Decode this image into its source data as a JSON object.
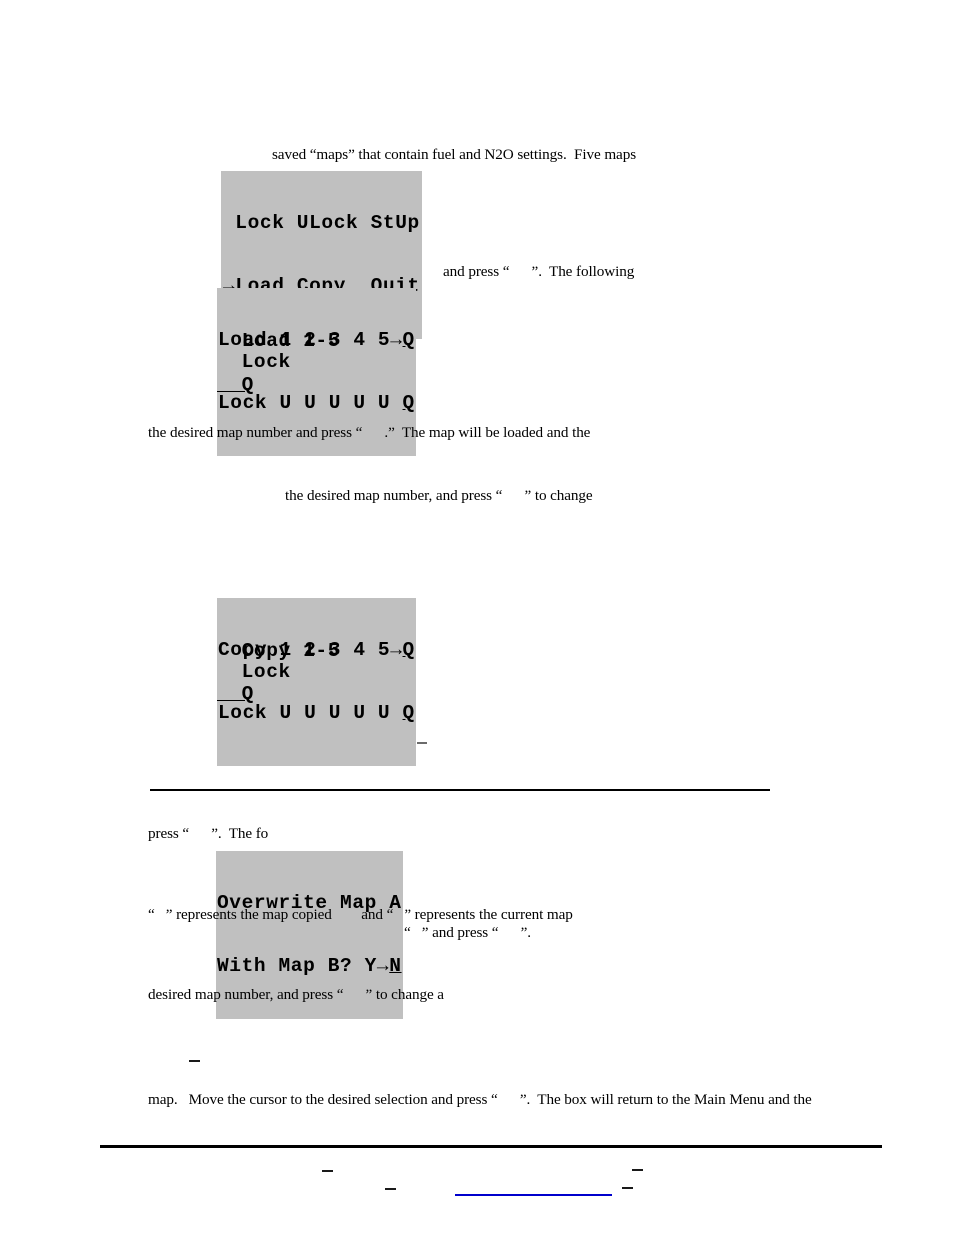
{
  "document": {
    "page_background": "#ffffff",
    "text_color": "#000000",
    "lcd_background": "#c0c0c0",
    "link_color": "#0000cc"
  },
  "paragraphs": {
    "line_saved_maps": "saved “maps” that contain fuel and N2O settings.  Five maps",
    "line_and_press_following": "and press “      ”.  The following",
    "line_desired_map_loaded": "the desired map number and press “      .”  The map will be loaded and the",
    "line_desired_map_change": "the desired map number, and press “      ” to change",
    "line_press_the_fo": "press “      ”.  The fo",
    "line_represents_copied": "“   ” represents the map copied        and “   ” represents the current map",
    "line_and_press_short": "“   ” and press “      ”.",
    "line_desired_map_change_a": "desired map number, and press “      ” to change a",
    "line_map_move_cursor": "map.   Move the cursor to the desired selection and press “      ”.  The box will return to the Main Menu and the"
  },
  "lcd_displays": {
    "main_menu": {
      "name": "main-menu-display",
      "line1": " Lock ULock StUp",
      "line2_prefix": "→",
      "line2_cursor_char": "L",
      "line2_rest": "oad Copy  Quit"
    },
    "load_menu": {
      "name": "load-map-display",
      "line1_prefix": "Load 1 2 3 4 5→",
      "line1_cursor_char": "Q",
      "line2_prefix": "Lock U U U U U ",
      "line2_cursor_char": "Q",
      "legend": [
        "  Load 1-5",
        "  Lock",
        "  Q"
      ]
    },
    "copy_menu": {
      "name": "copy-map-display",
      "line1_prefix": "Copy 1 2 3 4 5→",
      "line1_cursor_char": "Q",
      "line2_prefix": "Lock U U U U U ",
      "line2_cursor_char": "Q",
      "legend": [
        "  Copy 1-5",
        "  Lock",
        "  Q"
      ]
    },
    "overwrite_prompt": {
      "name": "overwrite-confirm-display",
      "line1": "Overwrite Map A",
      "line2_prefix": "With Map B? Y→",
      "line2_cursor_char": "N"
    }
  },
  "footer": {
    "link_label": "",
    "separator_visible": true
  }
}
